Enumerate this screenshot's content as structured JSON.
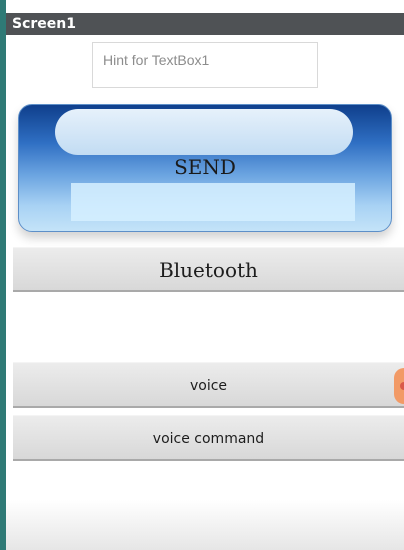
{
  "screen": {
    "title": "Screen1"
  },
  "textbox": {
    "hint": "Hint for TextBox1"
  },
  "buttons": {
    "send": "SEND",
    "bluetooth": "Bluetooth",
    "voice": "voice",
    "voice_command": "voice command"
  },
  "colors": {
    "title_bar": "#4f5255",
    "accent_edge": "#2f7a76",
    "send_top": "#0f3f8c",
    "send_bottom": "#c4e3f8",
    "button_gray": "#dedede",
    "floating_button": "#f29a66"
  }
}
